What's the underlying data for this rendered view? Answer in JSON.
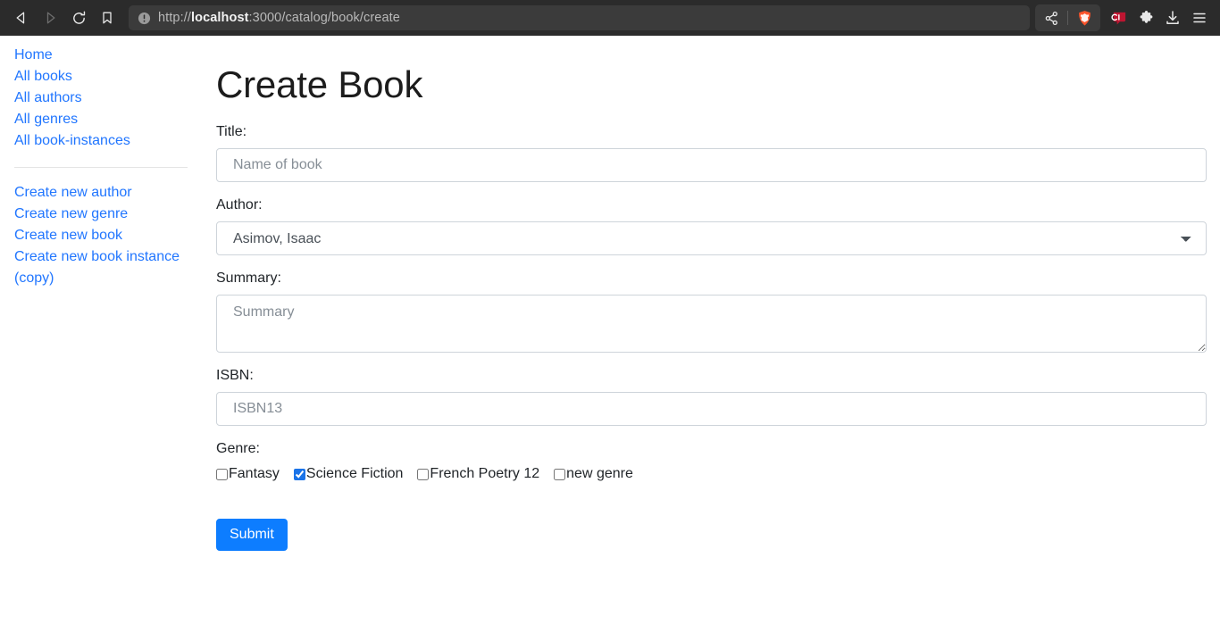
{
  "browser": {
    "nav": {
      "back_label": "Back",
      "forward_label": "Forward",
      "reload_label": "Reload",
      "bookmark_label": "Bookmark this page"
    },
    "url": {
      "scheme": "http://",
      "host": "localhost",
      "rest": ":3000/catalog/book/create",
      "full": "http://localhost:3000/catalog/book/create",
      "site_info_icon": "info-circle-icon"
    },
    "toolbar_icons": [
      {
        "name": "share-icon",
        "label": "Share"
      },
      {
        "name": "brave-shields-icon",
        "label": "Brave Shields"
      },
      {
        "name": "brave-leo-icon",
        "label": "Leo AI"
      },
      {
        "name": "extensions-puzzle-icon",
        "label": "Extensions"
      },
      {
        "name": "downloads-icon",
        "label": "Downloads"
      },
      {
        "name": "browser-menu-icon",
        "label": "Customize and control Brave"
      }
    ],
    "colors": {
      "chrome_bg": "#2b2b2b",
      "urlbar_bg": "#3b3b3b",
      "brave_orange": "#fb542b"
    }
  },
  "sidebar": {
    "primary_links": [
      {
        "label": "Home"
      },
      {
        "label": "All books"
      },
      {
        "label": "All authors"
      },
      {
        "label": "All genres"
      },
      {
        "label": "All book-instances"
      }
    ],
    "secondary_links": [
      {
        "label": "Create new author"
      },
      {
        "label": "Create new genre"
      },
      {
        "label": "Create new book"
      },
      {
        "label": "Create new book instance (copy)"
      }
    ],
    "link_color": "#2176ff"
  },
  "main": {
    "page_title": "Create Book",
    "fields": {
      "title": {
        "label": "Title:",
        "placeholder": "Name of book",
        "value": ""
      },
      "author": {
        "label": "Author:",
        "selected": "Asimov, Isaac",
        "options": [
          "Asimov, Isaac"
        ]
      },
      "summary": {
        "label": "Summary:",
        "placeholder": "Summary",
        "value": ""
      },
      "isbn": {
        "label": "ISBN:",
        "placeholder": "ISBN13",
        "value": ""
      },
      "genre": {
        "label": "Genre:",
        "options": [
          {
            "label": "Fantasy",
            "checked": false
          },
          {
            "label": "Science Fiction",
            "checked": true
          },
          {
            "label": "French Poetry 12",
            "checked": false
          },
          {
            "label": "new genre",
            "checked": false
          }
        ]
      }
    },
    "submit_label": "Submit",
    "submit_color": "#0d7dff"
  }
}
